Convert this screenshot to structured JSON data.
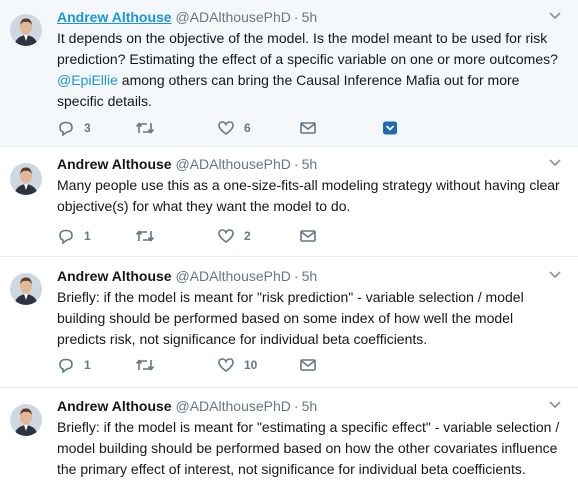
{
  "tweets": [
    {
      "name": "Andrew Althouse",
      "handle": "@ADAlthousePhD",
      "time": "5h",
      "text_before": "It depends on the objective of the model.  Is the model meant to be used for risk prediction?  Estimating the effect of a specific variable on one or more outcomes?  ",
      "mention": "@EpiEllie",
      "text_after": " among others can bring the Causal Inference Mafia out for more specific details.",
      "replies": "3",
      "retweets": "",
      "likes": "6"
    },
    {
      "name": "Andrew Althouse",
      "handle": "@ADAlthousePhD",
      "time": "5h",
      "text": "Many people use this as a one-size-fits-all modeling strategy without having clear objective(s) for what they want the model to do.",
      "replies": "1",
      "retweets": "",
      "likes": "2"
    },
    {
      "name": "Andrew Althouse",
      "handle": "@ADAlthousePhD",
      "time": "5h",
      "text": "Briefly: if the model is meant for \"risk prediction\" - variable selection / model building should be performed based on some index of how well the model predicts risk, not significance for individual beta coefficients.",
      "replies": "1",
      "retweets": "",
      "likes": "10"
    },
    {
      "name": "Andrew Althouse",
      "handle": "@ADAlthousePhD",
      "time": "5h",
      "text": "Briefly: if the model is meant for \"estimating a specific effect\" - variable selection / model building should be performed based on how the other covariates influence the primary effect of interest, not significance for individual beta coefficients.",
      "replies": "",
      "retweets": "",
      "likes": ""
    }
  ],
  "icons": {
    "reply": "reply-icon",
    "retweet": "retweet-icon",
    "like": "heart-icon",
    "dm": "envelope-icon",
    "bookmark": "bookmark-icon",
    "caret": "chevron-down-icon"
  },
  "colors": {
    "link": "#1b95e0",
    "muted": "#657786",
    "highlight_bg": "#f5f8fa",
    "bookmark": "#1c6db5"
  }
}
